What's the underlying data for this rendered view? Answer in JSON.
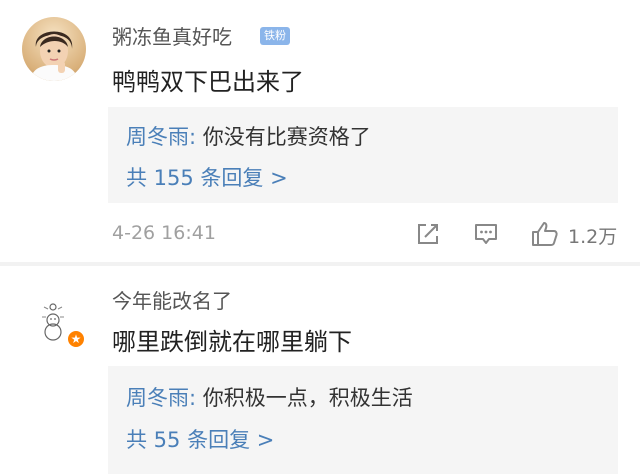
{
  "comments": [
    {
      "username": "粥冻鱼真好吃",
      "badge": "铁粉",
      "content": "鸭鸭双下巴出来了",
      "reply": {
        "author": "周冬雨",
        "sep": ": ",
        "text": "你没有比赛资格了",
        "more": "共 155 条回复 >"
      },
      "timestamp": "4-26 16:41",
      "likes": "1.2万"
    },
    {
      "username": "今年能改名了",
      "content": "哪里跌倒就在哪里躺下",
      "reply": {
        "author": "周冬雨",
        "sep": ": ",
        "text": "你积极一点，积极生活",
        "more": "共 55 条回复 >"
      }
    }
  ],
  "icons": {
    "edit": "share-edit-icon",
    "comment": "comment-icon",
    "like": "thumbs-up-icon",
    "verified": "star-badge-icon"
  },
  "colors": {
    "link": "#4a7fb8",
    "badge": "#8bb5ea",
    "verified": "#ff8200"
  }
}
